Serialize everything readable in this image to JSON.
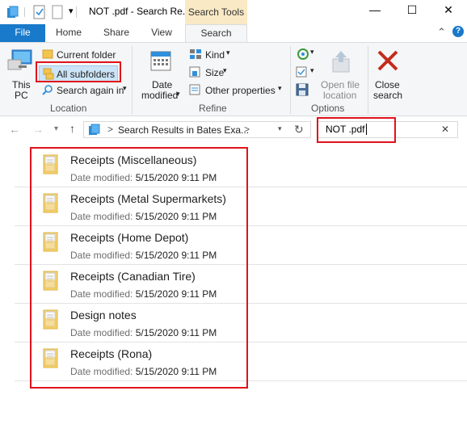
{
  "window": {
    "title": "NOT .pdf - Search Re...",
    "context_tab_label": "Search Tools",
    "minimize_glyph": "—",
    "maximize_glyph": "☐",
    "close_glyph": "✕",
    "quick_access_chevron": "▾"
  },
  "tabs": [
    {
      "label": "File"
    },
    {
      "label": "Home"
    },
    {
      "label": "Share"
    },
    {
      "label": "View"
    },
    {
      "label": "Search"
    }
  ],
  "ribbon": {
    "location": {
      "this_pc_line1": "This",
      "this_pc_line2": "PC",
      "current_folder": "Current folder",
      "all_subfolders": "All subfolders",
      "search_again_in": "Search again in",
      "group_label": "Location"
    },
    "refine": {
      "date_modified_line1": "Date",
      "date_modified_line2": "modified",
      "kind": "Kind",
      "size": "Size",
      "other_properties": "Other properties",
      "group_label": "Refine"
    },
    "options": {
      "open_file_location_line1": "Open file",
      "open_file_location_line2": "location",
      "group_label": "Options"
    },
    "close_search_line1": "Close",
    "close_search_line2": "search",
    "collapse_glyph": "⌃",
    "help_glyph": "?"
  },
  "address_bar": {
    "path": "Search Results in Bates Exa...",
    "chevron": ">",
    "search_value": "NOT .pdf",
    "clear_glyph": "✕"
  },
  "results": [
    {
      "name": "Receipts (Miscellaneous)",
      "date_label": "Date modified:",
      "date": "5/15/2020 9:11 PM"
    },
    {
      "name": "Receipts (Metal Supermarkets)",
      "date_label": "Date modified:",
      "date": "5/15/2020 9:11 PM"
    },
    {
      "name": "Receipts (Home Depot)",
      "date_label": "Date modified:",
      "date": "5/15/2020 9:11 PM"
    },
    {
      "name": "Receipts (Canadian Tire)",
      "date_label": "Date modified:",
      "date": "5/15/2020 9:11 PM"
    },
    {
      "name": "Design notes",
      "date_label": "Date modified:",
      "date": "5/15/2020 9:11 PM"
    },
    {
      "name": "Receipts (Rona)",
      "date_label": "Date modified:",
      "date": "5/15/2020 9:11 PM"
    }
  ],
  "colors": {
    "file_tab": "#1979ca",
    "context_tab": "#f9e9c4",
    "highlight_box": "#e0121b",
    "close_search_x": "#c42b1c"
  }
}
